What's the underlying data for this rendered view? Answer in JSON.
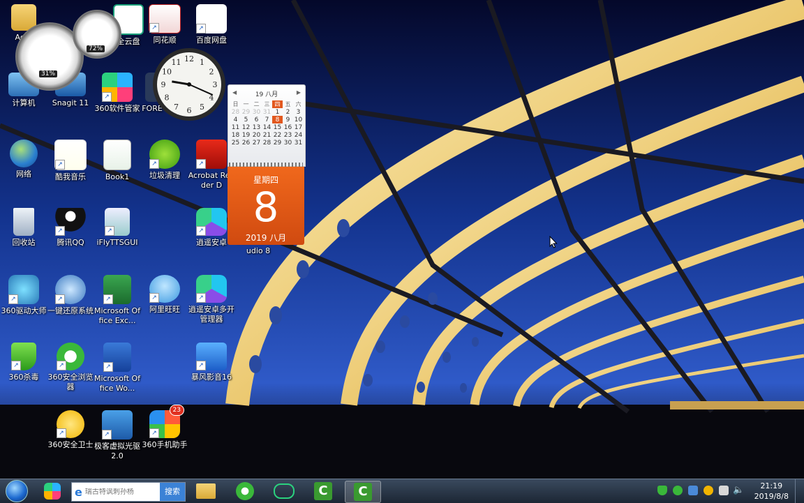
{
  "desktop": {
    "icons": [
      {
        "label": "Adm",
        "id": "admin-folder"
      },
      {
        "label": "计算机",
        "id": "computer"
      },
      {
        "label": "Snagit 11",
        "id": "snagit"
      },
      {
        "label": "360软件管家",
        "id": "360-software-manager"
      },
      {
        "label": "FORE",
        "id": "fore"
      },
      {
        "label": "全云盘",
        "id": "cloud-disk"
      },
      {
        "label": "同花顺",
        "id": "tonghuashun"
      },
      {
        "label": "百度网盘",
        "id": "baidu-netdisk"
      },
      {
        "label": "网络",
        "id": "network"
      },
      {
        "label": "酷我音乐",
        "id": "kuwo-music"
      },
      {
        "label": "Book1",
        "id": "book1"
      },
      {
        "label": "垃圾清理",
        "id": "junk-cleaner"
      },
      {
        "label": "Acrobat Reader D",
        "id": "acrobat-reader"
      },
      {
        "label": "回收站",
        "id": "recycle-bin"
      },
      {
        "label": "腾讯QQ",
        "id": "tencent-qq"
      },
      {
        "label": "iFlyTTSGUI",
        "id": "iflytts"
      },
      {
        "label": "逍遥安卓",
        "id": "xiaoyao-android"
      },
      {
        "label": "Camtasia Studio 8",
        "id": "camtasia"
      },
      {
        "label": "360驱动大师",
        "id": "360-driver"
      },
      {
        "label": "一键还原系统",
        "id": "one-key-restore"
      },
      {
        "label": "Microsoft Office Exc...",
        "id": "ms-excel"
      },
      {
        "label": "阿里旺旺",
        "id": "aliwangwang"
      },
      {
        "label": "逍遥安卓多开管理器",
        "id": "xiaoyao-multi"
      },
      {
        "label": "360杀毒",
        "id": "360-antivirus"
      },
      {
        "label": "360安全浏览器",
        "id": "360-browser"
      },
      {
        "label": "Microsoft Office Wo...",
        "id": "ms-word"
      },
      {
        "label": "暴风影音16",
        "id": "baofeng"
      },
      {
        "label": "360安全卫士",
        "id": "360-security"
      },
      {
        "label": "极客虚拟光驱2.0",
        "id": "geek-vdrive"
      },
      {
        "label": "360手机助手",
        "id": "360-phone",
        "badge": "23"
      }
    ]
  },
  "gadgets": {
    "cpu_meter": {
      "cpu": "31%",
      "memory": "72%"
    },
    "calendar": {
      "header": "19 八月",
      "weekdays": [
        "日",
        "一",
        "二",
        "三",
        "四",
        "五",
        "六"
      ],
      "weeks": [
        [
          "28",
          "29",
          "30",
          "31",
          "1",
          "2",
          "3"
        ],
        [
          "4",
          "5",
          "6",
          "7",
          "8",
          "9",
          "10"
        ],
        [
          "11",
          "12",
          "13",
          "14",
          "15",
          "16",
          "17"
        ],
        [
          "18",
          "19",
          "20",
          "21",
          "22",
          "23",
          "24"
        ],
        [
          "25",
          "26",
          "27",
          "28",
          "29",
          "30",
          "31"
        ]
      ],
      "today": "8",
      "weekday_label": "星期四",
      "day": "8",
      "month_year": "2019 八月"
    },
    "clock": {
      "hour": 9,
      "minute": 19
    }
  },
  "taskbar": {
    "search_placeholder": "瑞古特讽刺孙杨",
    "search_button": "搜索",
    "time": "21:19",
    "date": "2019/8/8"
  },
  "colors": {
    "taskbar": "#1c2634",
    "calendar_accent": "#e2581e",
    "search_button": "#3b82d6"
  }
}
